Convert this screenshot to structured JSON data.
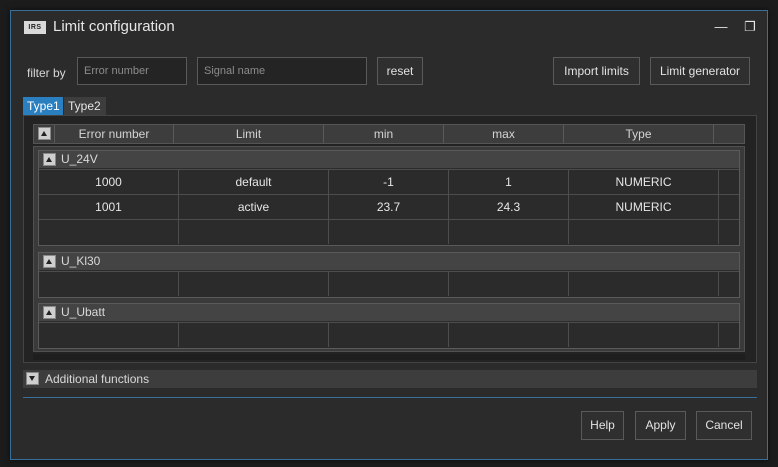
{
  "window": {
    "logo_text": "IRS",
    "title": "Limit configuration",
    "minimize_symbol": "—",
    "restore_symbol": "❐"
  },
  "filter": {
    "label": "filter by",
    "error_number_placeholder": "Error number",
    "signal_name_placeholder": "Signal name",
    "reset_label": "reset"
  },
  "toolbar": {
    "import_limits_label": "Import limits",
    "limit_generator_label": "Limit generator"
  },
  "tabs": [
    {
      "label": "Type1",
      "active": true
    },
    {
      "label": "Type2",
      "active": false
    }
  ],
  "table": {
    "columns": [
      "Error number",
      "Limit",
      "min",
      "max",
      "Type"
    ],
    "groups": [
      {
        "name": "U_24V",
        "rows": [
          [
            "1000",
            "default",
            "-1",
            "1",
            "NUMERIC"
          ],
          [
            "1001",
            "active",
            "23.7",
            "24.3",
            "NUMERIC"
          ],
          [
            "",
            "",
            "",
            "",
            ""
          ]
        ]
      },
      {
        "name": "U_Kl30",
        "rows": [
          [
            "",
            "",
            "",
            "",
            ""
          ]
        ]
      },
      {
        "name": "U_Ubatt",
        "rows": [
          [
            "",
            "",
            "",
            "",
            ""
          ]
        ]
      }
    ]
  },
  "additional_functions": {
    "label": "Additional functions"
  },
  "footer": {
    "help_label": "Help",
    "apply_label": "Apply",
    "cancel_label": "Cancel"
  },
  "colors": {
    "accent": "#2a7fc0",
    "background": "#2b2b2b",
    "header": "#3d3d3d"
  }
}
